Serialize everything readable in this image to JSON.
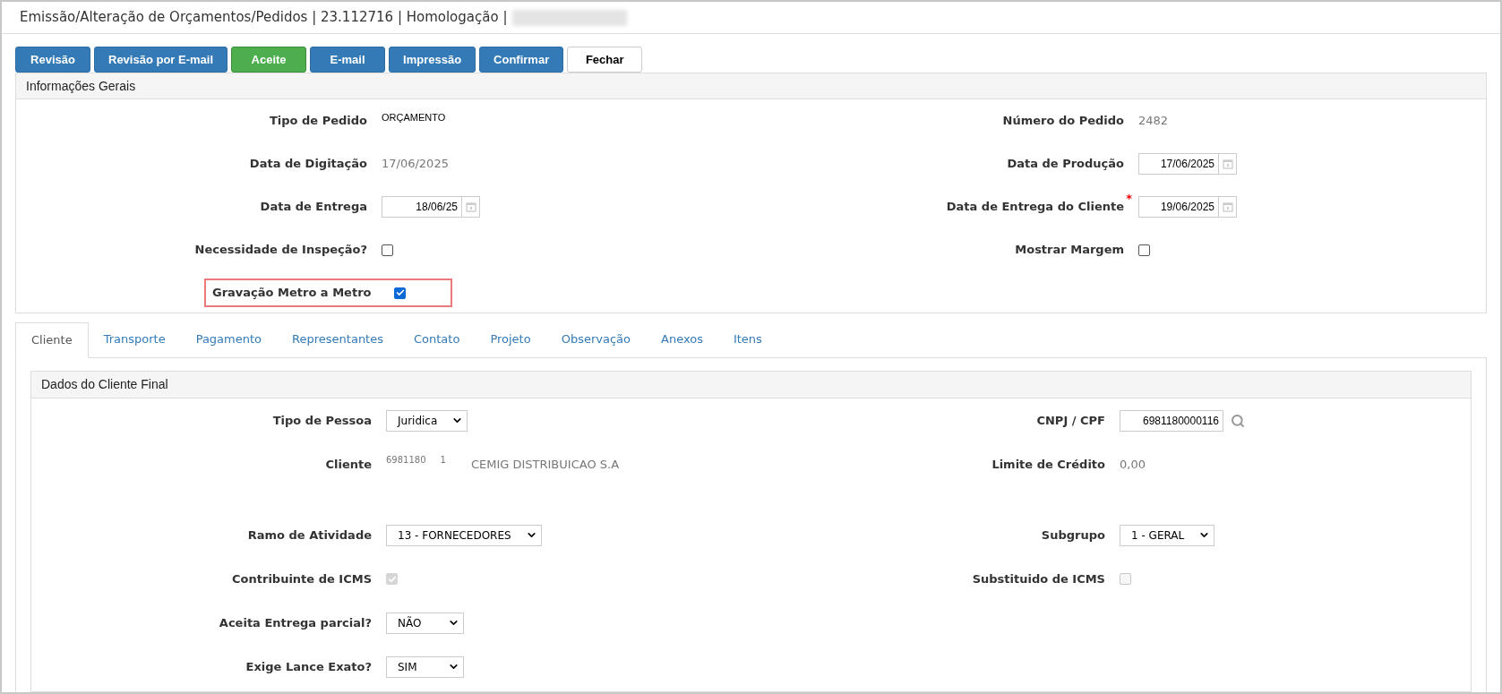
{
  "window": {
    "title": "Emissão/Alteração de Orçamentos/Pedidos | 23.112716 | Homologação |"
  },
  "toolbar": [
    {
      "label": "Revisão",
      "kind": "primary"
    },
    {
      "label": "Revisão por E-mail",
      "kind": "primary"
    },
    {
      "label": "Aceite",
      "kind": "success"
    },
    {
      "label": "E-mail",
      "kind": "primary"
    },
    {
      "label": "Impressão",
      "kind": "primary"
    },
    {
      "label": "Confirmar",
      "kind": "primary"
    },
    {
      "label": "Fechar",
      "kind": "default"
    }
  ],
  "general": {
    "title": "Informações Gerais",
    "rows": [
      {
        "left": {
          "label": "Tipo de Pedido",
          "kind": "strong",
          "value": "ORÇAMENTO"
        },
        "right": {
          "label": "Número do Pedido",
          "kind": "text",
          "value": "2482"
        }
      },
      {
        "left": {
          "label": "Data de Digitação",
          "kind": "text",
          "value": "17/06/2025"
        },
        "right": {
          "label": "Data de Produção",
          "kind": "date",
          "value": "17/06/2025"
        }
      },
      {
        "left": {
          "label": "Data de Entrega",
          "kind": "date",
          "value": "18/06/25"
        },
        "right": {
          "label": "Data de Entrega do Cliente",
          "kind": "date",
          "value": "19/06/2025",
          "required_mark": "*"
        }
      },
      {
        "left": {
          "label": "Necessidade de Inspeção?",
          "kind": "checkbox",
          "checked": false,
          "disabled": false
        },
        "right": {
          "label": "Mostrar Margem",
          "kind": "checkbox",
          "checked": false,
          "disabled": false
        }
      },
      {
        "left": {
          "label": "Gravação Metro a Metro",
          "kind": "checkbox",
          "checked": true,
          "disabled": false,
          "highlighted": true
        }
      }
    ]
  },
  "tabs": [
    {
      "label": "Cliente",
      "selected": true
    },
    {
      "label": "Transporte",
      "selected": false
    },
    {
      "label": "Pagamento",
      "selected": false
    },
    {
      "label": "Representantes",
      "selected": false
    },
    {
      "label": "Contato",
      "selected": false
    },
    {
      "label": "Projeto",
      "selected": false
    },
    {
      "label": "Observação",
      "selected": false
    },
    {
      "label": "Anexos",
      "selected": false
    },
    {
      "label": "Itens",
      "selected": false
    }
  ],
  "client": {
    "title": "Dados do Cliente Final",
    "rows": [
      {
        "left": {
          "label": "Tipo de Pessoa",
          "kind": "select",
          "value": "Juridica"
        },
        "right": {
          "label": "CNPJ / CPF",
          "kind": "lookup",
          "value": "6981180000116"
        }
      },
      {
        "left": {
          "label": "Cliente",
          "kind": "client",
          "parts": [
            "6981180",
            "1",
            "CEMIG DISTRIBUICAO S.A"
          ]
        },
        "right": {
          "label": "Limite de Crédito",
          "kind": "text",
          "value": "0,00"
        }
      },
      {
        "left": {
          "label": "Ramo de Atividade",
          "kind": "select",
          "value": "13 - FORNECEDORES"
        },
        "right": {
          "label": "Subgrupo",
          "kind": "select",
          "value": "1 - GERAL"
        }
      },
      {
        "left": {
          "label": "Contribuinte de ICMS",
          "kind": "checkbox",
          "checked": true,
          "disabled": true
        },
        "right": {
          "label": "Substituido de ICMS",
          "kind": "checkbox",
          "checked": false,
          "disabled": true
        }
      },
      {
        "left": {
          "label": "Aceita Entrega parcial?",
          "kind": "select",
          "value": "NÃO"
        }
      },
      {
        "left": {
          "label": "Exige Lance Exato?",
          "kind": "select",
          "value": "SIM"
        }
      }
    ]
  }
}
